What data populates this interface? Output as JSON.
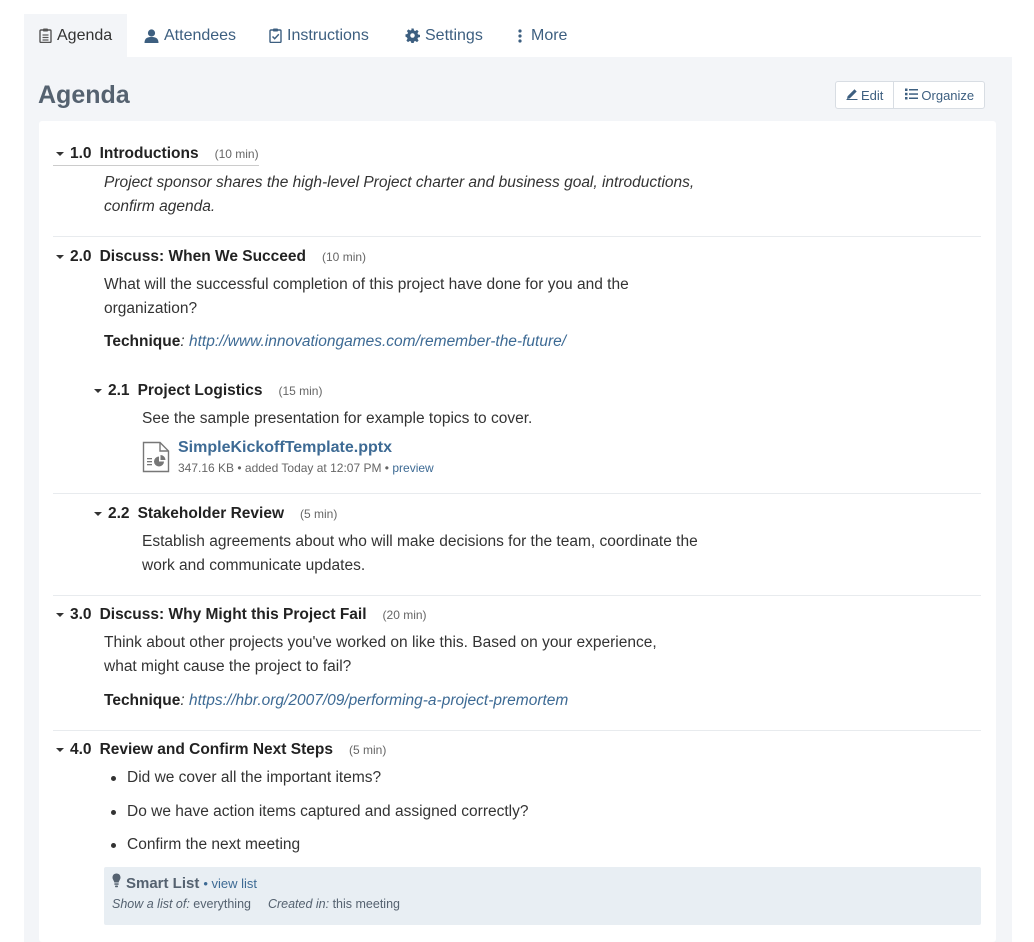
{
  "tabs": [
    {
      "label": "Agenda",
      "icon": "clipboard-list-icon"
    },
    {
      "label": "Attendees",
      "icon": "user-icon"
    },
    {
      "label": "Instructions",
      "icon": "clipboard-check-icon"
    },
    {
      "label": "Settings",
      "icon": "gear-icon"
    },
    {
      "label": "More",
      "icon": "vertical-ellipsis-icon"
    }
  ],
  "page": {
    "title": "Agenda"
  },
  "toolbar": {
    "edit_label": "Edit",
    "organize_label": "Organize"
  },
  "colors": {
    "link": "#3d6a94",
    "tab_text": "#3d5f80",
    "panel_bg": "#f3f5f8",
    "smart_bg": "#e8eef3"
  },
  "agenda": {
    "items": [
      {
        "number": "1.0",
        "title": "Introductions",
        "duration": "(10 min)",
        "description_lines": [
          "Project sponsor shares the high-level Project charter and business goal, introductions,",
          "confirm agenda."
        ]
      },
      {
        "number": "2.0",
        "title": "Discuss: When We Succeed",
        "duration": "(10 min)",
        "description_lines": [
          "What will the successful completion of this project  have done for you and the",
          "organization?"
        ],
        "technique_label": "Technique",
        "technique_colon": ":",
        "technique_link": "http://www.innovationgames.com/remember-the-future/"
      },
      {
        "number": "2.1",
        "title": "Project Logistics",
        "duration": "(15 min)",
        "description_lines": [
          "See the sample presentation for example topics to cover."
        ],
        "attachment": {
          "icon": "powerpoint-file-icon",
          "filename": "SimpleKickoffTemplate.pptx",
          "meta": "347.16 KB • added Today at 12:07 PM • ",
          "preview_label": "preview"
        }
      },
      {
        "number": "2.2",
        "title": "Stakeholder Review",
        "duration": "(5 min)",
        "description_lines": [
          "Establish agreements about who will make decisions for the team, coordinate the",
          "work and communicate updates."
        ]
      },
      {
        "number": "3.0",
        "title": "Discuss: Why Might this Project Fail",
        "duration": "(20 min)",
        "description_lines": [
          "Think about other projects you've worked on like this. Based on your experience,",
          "what might cause the project to fail?"
        ],
        "technique_label": "Technique",
        "technique_colon": ":",
        "technique_link": "https://hbr.org/2007/09/performing-a-project-premortem"
      },
      {
        "number": "4.0",
        "title": "Review and Confirm Next Steps",
        "duration": "(5 min)",
        "bullets": [
          "Did we cover all the important items?",
          "Do we have action items captured and assigned correctly?",
          "Confirm the next meeting"
        ]
      }
    ]
  },
  "smart_list": {
    "icon": "lightbulb-icon",
    "title": "Smart List",
    "view_link": "• view list",
    "show_label": "Show a list of:",
    "show_value": " everything",
    "created_label": "Created in:",
    "created_value": " this meeting"
  }
}
